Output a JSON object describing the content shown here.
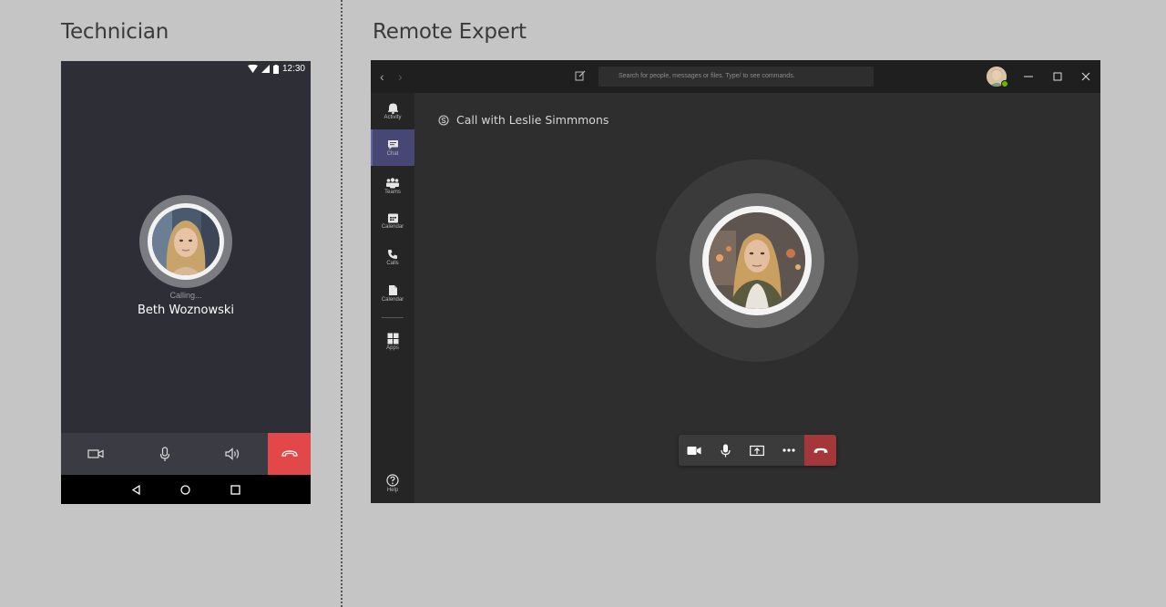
{
  "sections": {
    "technician_title": "Technician",
    "remote_expert_title": "Remote Expert"
  },
  "phone": {
    "status_time": "12:30",
    "calling_label": "Calling...",
    "caller_name": "Beth Woznowski",
    "controls": [
      "video-camera-icon",
      "microphone-icon",
      "speaker-icon",
      "hang-up-icon"
    ],
    "nav": [
      "back-triangle-icon",
      "home-circle-icon",
      "recents-square-icon"
    ],
    "end_color": "#e2474a"
  },
  "teams": {
    "search_placeholder": "Search for people, messages or files. Type/ to see commands.",
    "rail": [
      {
        "label": "Activity",
        "icon": "bell-icon"
      },
      {
        "label": "Chat",
        "icon": "chat-icon",
        "active": true
      },
      {
        "label": "Teams",
        "icon": "teams-icon"
      },
      {
        "label": "Calendar",
        "icon": "calendar-icon"
      },
      {
        "label": "Calls",
        "icon": "phone-icon"
      },
      {
        "label": "Calendar",
        "icon": "files-icon"
      },
      {
        "label": "Apps",
        "icon": "apps-icon"
      }
    ],
    "help_label": "Help",
    "call_title": "Call with Leslie Simmmons",
    "call_controls": [
      "video-camera-icon",
      "microphone-icon",
      "share-screen-icon",
      "more-icon",
      "hang-up-icon"
    ],
    "accent": "#6264a7",
    "end_color": "#a4373a"
  }
}
